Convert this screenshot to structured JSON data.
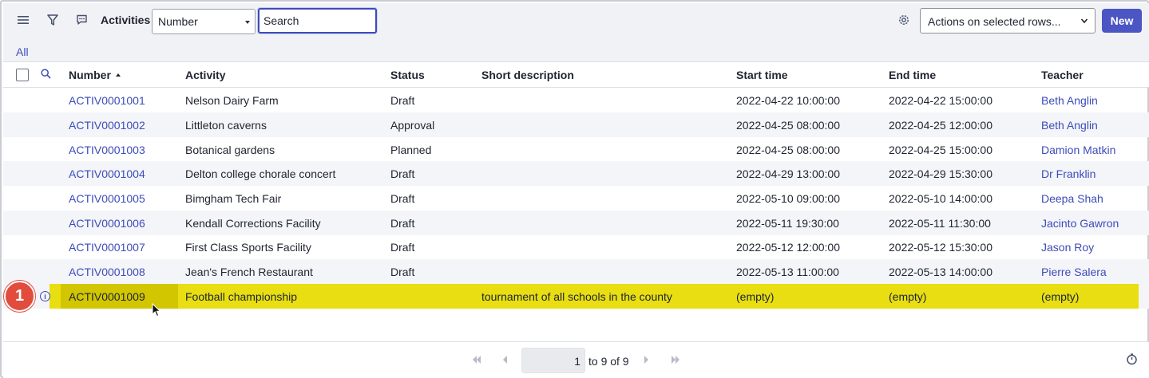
{
  "toolbar": {
    "title": "Activities",
    "field_select_value": "Number",
    "search_placeholder": "Search",
    "actions_select_value": "Actions on selected rows...",
    "new_label": "New"
  },
  "breadcrumb": {
    "all_label": "All"
  },
  "columns": {
    "number": "Number",
    "activity": "Activity",
    "status": "Status",
    "short_description": "Short description",
    "start_time": "Start time",
    "end_time": "End time",
    "teacher": "Teacher"
  },
  "rows": [
    {
      "number": "ACTIV0001001",
      "activity": "Nelson Dairy Farm",
      "status": "Draft",
      "short_description": "",
      "start_time": "2022-04-22 10:00:00",
      "end_time": "2022-04-22 15:00:00",
      "teacher": "Beth Anglin"
    },
    {
      "number": "ACTIV0001002",
      "activity": "Littleton caverns",
      "status": "Approval",
      "short_description": "",
      "start_time": "2022-04-25 08:00:00",
      "end_time": "2022-04-25 12:00:00",
      "teacher": "Beth Anglin"
    },
    {
      "number": "ACTIV0001003",
      "activity": "Botanical gardens",
      "status": "Planned",
      "short_description": "",
      "start_time": "2022-04-25 08:00:00",
      "end_time": "2022-04-25 15:00:00",
      "teacher": "Damion Matkin"
    },
    {
      "number": "ACTIV0001004",
      "activity": "Delton college chorale concert",
      "status": "Draft",
      "short_description": "",
      "start_time": "2022-04-29 13:00:00",
      "end_time": "2022-04-29 15:30:00",
      "teacher": "Dr Franklin"
    },
    {
      "number": "ACTIV0001005",
      "activity": "Bimgham Tech Fair",
      "status": "Draft",
      "short_description": "",
      "start_time": "2022-05-10 09:00:00",
      "end_time": "2022-05-10 14:00:00",
      "teacher": "Deepa Shah"
    },
    {
      "number": "ACTIV0001006",
      "activity": "Kendall Corrections Facility",
      "status": "Draft",
      "short_description": "",
      "start_time": "2022-05-11 19:30:00",
      "end_time": "2022-05-11 11:30:00",
      "teacher": "Jacinto Gawron"
    },
    {
      "number": "ACTIV0001007",
      "activity": "First Class Sports Facility",
      "status": "Draft",
      "short_description": "",
      "start_time": "2022-05-12 12:00:00",
      "end_time": "2022-05-12 15:30:00",
      "teacher": "Jason Roy"
    },
    {
      "number": "ACTIV0001008",
      "activity": "Jean's French Restaurant",
      "status": "Draft",
      "short_description": "",
      "start_time": "2022-05-13 11:00:00",
      "end_time": "2022-05-13 14:00:00",
      "teacher": "Pierre Salera"
    },
    {
      "number": "ACTIV0001009",
      "activity": "Football championship",
      "status": "",
      "short_description": "tournament of all schools in the county",
      "start_time": "(empty)",
      "end_time": "(empty)",
      "teacher": "(empty)"
    }
  ],
  "annotation_badge": "1",
  "pagination": {
    "current_page": "1",
    "range_text": "to 9 of 9"
  },
  "colors": {
    "accent": "#4b55c4",
    "link": "#3c4cba",
    "highlight": "#e6dc00",
    "badge": "#e24c3c"
  }
}
